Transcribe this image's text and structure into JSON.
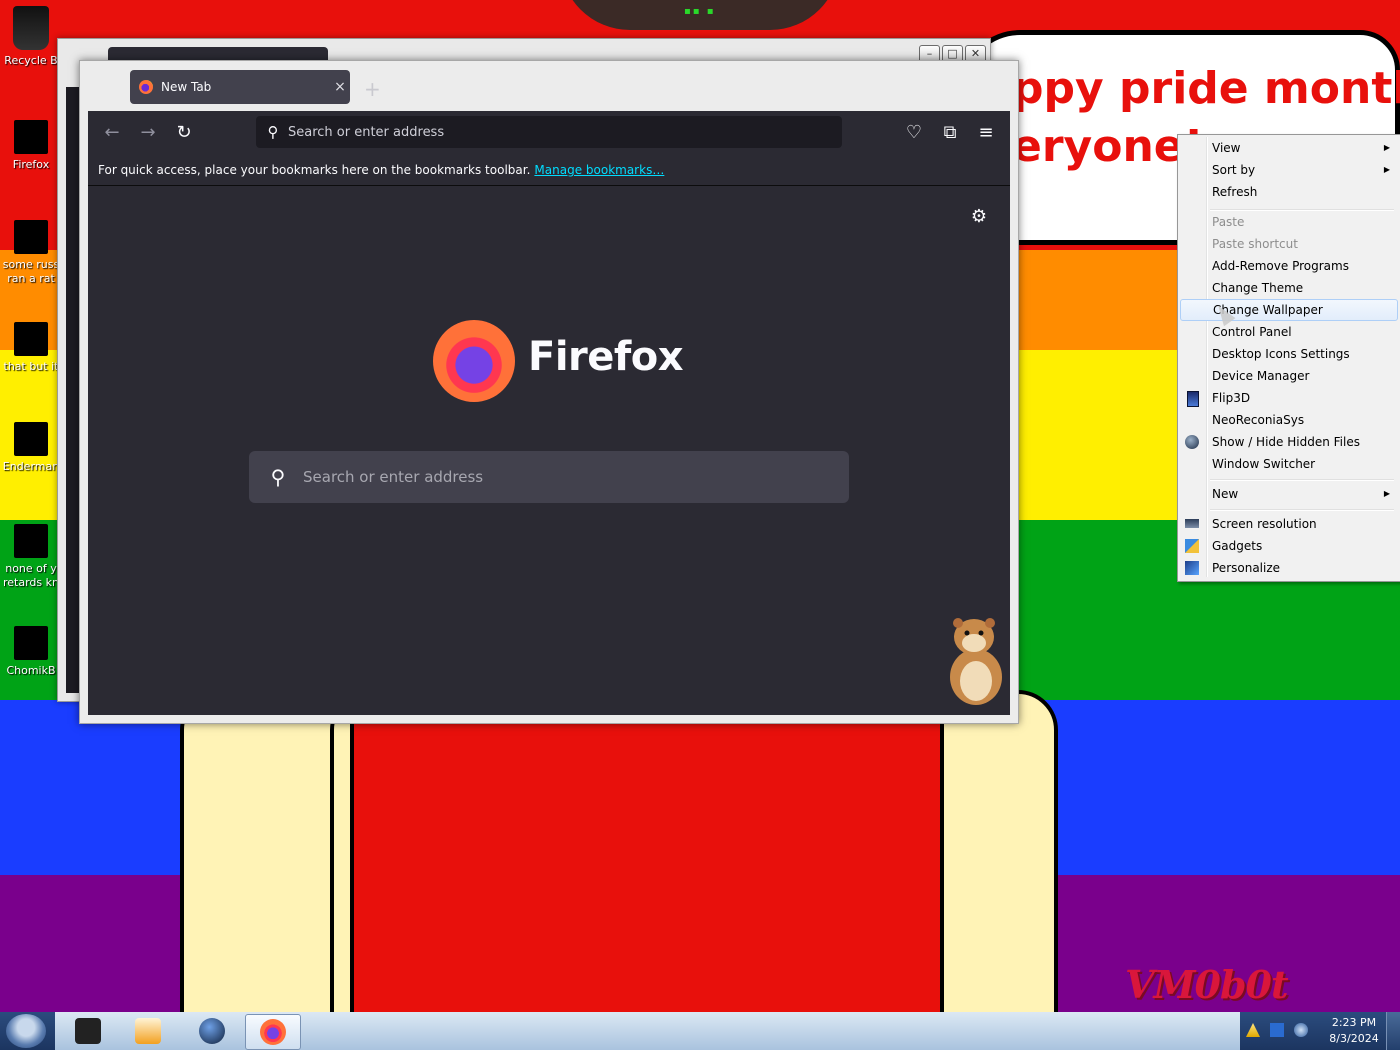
{
  "wallpaper": {
    "banner_lines": [
      "ppy pride month",
      "eryone!"
    ],
    "watermark": "VM0b0t",
    "colors": {
      "red": "#e8100c",
      "orange": "#ff8c00",
      "yellow": "#ffef00",
      "green": "#00a316",
      "blue": "#1a3dff",
      "purple": "#7a008c"
    }
  },
  "desktop_icons": [
    {
      "label": "Recycle B",
      "icon": "recycle-bin-icon"
    },
    {
      "label": "Firefox",
      "icon": "firefox-shortcut-icon"
    },
    {
      "label": "some russ ran a rat",
      "icon": "file-icon"
    },
    {
      "label": "that but it",
      "icon": "folder-icon"
    },
    {
      "label": "Enderman",
      "icon": "document-icon"
    },
    {
      "label": "none of y retards kn",
      "icon": "media-icon"
    },
    {
      "label": "ChomikB",
      "icon": "archive-icon"
    }
  ],
  "browser": {
    "tab_title": "New Tab",
    "new_tab_symbol": "+",
    "close_symbol": "×",
    "url_placeholder": "Search or enter address",
    "bookmarks_message": "For quick access, place your bookmarks here on the bookmarks toolbar.",
    "bookmarks_link": "Manage bookmarks…",
    "wordmark": "Firefox",
    "search_placeholder": "Search or enter address",
    "icons": [
      "back-icon",
      "forward-icon",
      "reload-icon",
      "pocket-icon",
      "extensions-icon",
      "menu-icon",
      "settings-gear-icon"
    ]
  },
  "context_menu": {
    "items": [
      {
        "label": "View",
        "submenu": true
      },
      {
        "label": "Sort by",
        "submenu": true
      },
      {
        "label": "Refresh"
      },
      {
        "label": "Paste",
        "disabled": true
      },
      {
        "label": "Paste shortcut",
        "disabled": true
      },
      {
        "label": "Add-Remove Programs"
      },
      {
        "label": "Change Theme"
      },
      {
        "label": "Change Wallpaper",
        "highlighted": true
      },
      {
        "label": "Control Panel"
      },
      {
        "label": "Desktop Icons Settings"
      },
      {
        "label": "Device Manager"
      },
      {
        "label": "Flip3D",
        "icon": "flip3d-icon"
      },
      {
        "label": "NeoReconiaSys"
      },
      {
        "label": "Show / Hide Hidden Files",
        "icon": "globe-icon"
      },
      {
        "label": "Window Switcher"
      },
      {
        "label": "New",
        "submenu": true
      },
      {
        "label": "Screen resolution",
        "icon": "monitor-icon"
      },
      {
        "label": "Gadgets",
        "icon": "gadgets-icon"
      },
      {
        "label": "Personalize",
        "icon": "personalize-icon"
      }
    ]
  },
  "taskbar": {
    "time": "2:23 PM",
    "date": "8/3/2024",
    "pinned": [
      "terminal-icon",
      "media-player-icon",
      "globe-browser-icon",
      "firefox-taskbar-icon"
    ]
  }
}
